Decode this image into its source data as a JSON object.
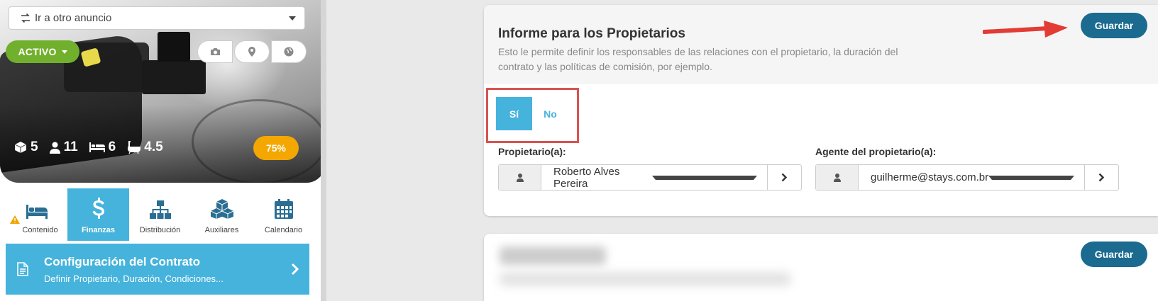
{
  "listing": {
    "nav_select_label": "Ir a otro anuncio",
    "status_label": "ACTIVO",
    "status_color": "#71b02d",
    "media_buttons": [
      "camera-icon",
      "map-pin-icon",
      "globe-icon"
    ],
    "stats": {
      "rooms": "5",
      "guests": "11",
      "beds": "6",
      "baths": "4.5"
    },
    "completion": "75%",
    "completion_color": "#f4a700"
  },
  "tabs": [
    {
      "label": "Contenido",
      "icon": "bed-icon",
      "warning": true
    },
    {
      "label": "Finanzas",
      "icon": "dollar-icon",
      "active": true
    },
    {
      "label": "Distribución",
      "icon": "sitemap-icon"
    },
    {
      "label": "Auxiliares",
      "icon": "cubes-icon"
    },
    {
      "label": "Calendario",
      "icon": "calendar-icon"
    }
  ],
  "contract_card": {
    "title": "Configuración del Contrato",
    "subtitle": "Definir Propietario, Duración, Condiciones..."
  },
  "owner_report": {
    "title": "Informe para los Propietarios",
    "description": "Esto le permite definir los responsables de las relaciones con el propietario, la duración del contrato y las políticas de comisión, por ejemplo.",
    "save_label": "Guardar",
    "toggle": {
      "yes": "Sí",
      "no": "No",
      "selected": "yes"
    },
    "owner_label": "Propietario(a):",
    "owner_value": "Roberto Alves Pereira",
    "agent_label": "Agente del propietario(a):",
    "agent_value": "guilherme@stays.com.br"
  },
  "second_card": {
    "save_label": "Guardar"
  },
  "colors": {
    "accent": "#45b3dc",
    "save_button": "#1b6a8f",
    "highlight": "#d9534f"
  }
}
